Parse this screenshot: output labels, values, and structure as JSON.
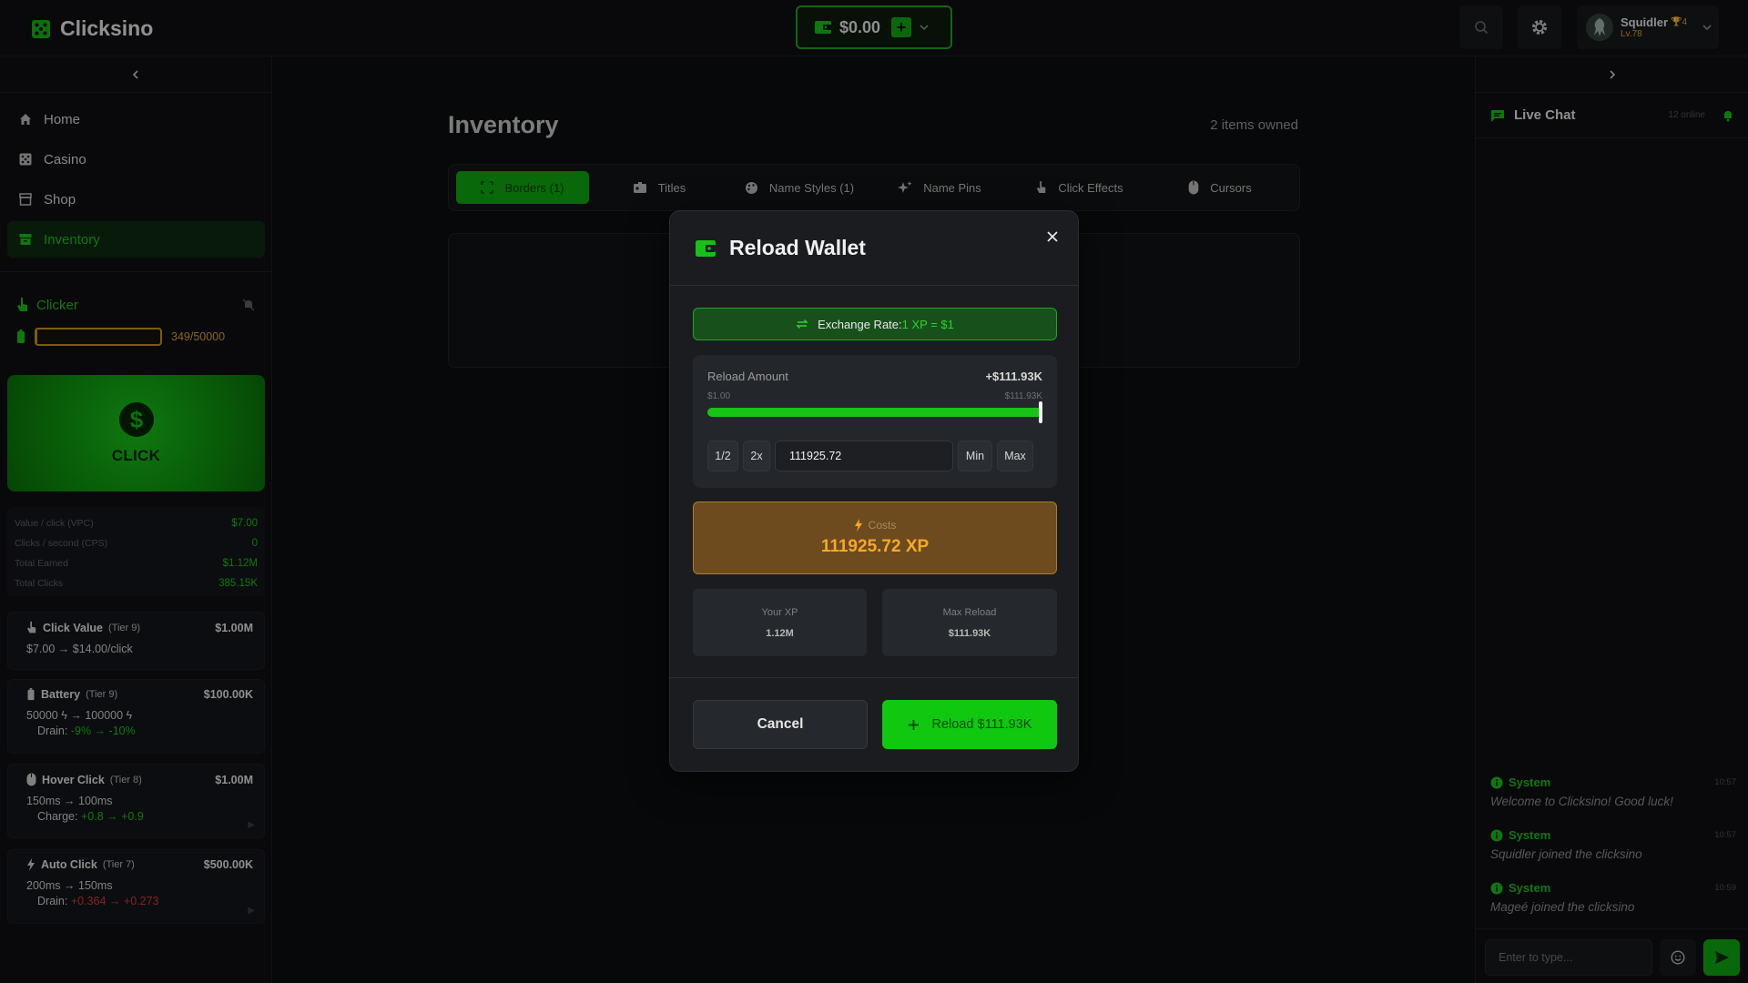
{
  "topbar": {
    "brand": "Clicksino",
    "wallet_amount": "$0.00",
    "wallet_add": "+",
    "profile": {
      "name": "Squidler",
      "level": "Lv.78",
      "badge_count": "4"
    }
  },
  "sidebar": {
    "nav": [
      {
        "label": "Home",
        "icon": "home-icon"
      },
      {
        "label": "Casino",
        "icon": "dice-icon"
      },
      {
        "label": "Shop",
        "icon": "store-icon"
      },
      {
        "label": "Inventory",
        "icon": "inventory-icon",
        "active": true
      }
    ],
    "clicker": {
      "title": "Clicker",
      "energy": "349/50000",
      "energy_fraction": 0.00698,
      "click_label": "CLICK"
    },
    "stats": [
      {
        "label": "Value / click (VPC)",
        "value": "$7.00"
      },
      {
        "label": "Clicks / second (CPS)",
        "value": "0"
      },
      {
        "label": "Total Earned",
        "value": "$1.12M"
      },
      {
        "label": "Total Clicks",
        "value": "385.15K"
      }
    ],
    "upgrades": [
      {
        "name": "Click Value",
        "tier": "(Tier 9)",
        "price": "$1.00M",
        "from": "$7.00",
        "to": "$14.00/click"
      },
      {
        "name": "Battery",
        "tier": "(Tier 9)",
        "price": "$100.00K",
        "from": "50000",
        "to": "100000",
        "drain_label": "Drain:",
        "drain_from": "-9%",
        "drain_to": "-10%"
      },
      {
        "name": "Hover Click",
        "tier": "(Tier 8)",
        "price": "$1.00M",
        "from": "150ms",
        "to": "100ms",
        "charge_label": "Charge:",
        "charge_from": "+0.8",
        "charge_to": "+0.9"
      },
      {
        "name": "Auto Click",
        "tier": "(Tier 7)",
        "price": "$500.00K",
        "from": "200ms",
        "to": "150ms",
        "drain_label": "Drain:",
        "drain_from": "+0.364",
        "drain_to": "+0.273"
      }
    ],
    "arrow": "→"
  },
  "main": {
    "title": "Inventory",
    "owned": "2 items owned",
    "tabs": [
      {
        "label": "Borders (1)",
        "icon": "border-icon",
        "active": true
      },
      {
        "label": "Titles",
        "icon": "id-card-icon"
      },
      {
        "label": "Name Styles (1)",
        "icon": "palette-icon"
      },
      {
        "label": "Name Pins",
        "icon": "sparkles-icon"
      },
      {
        "label": "Click Effects",
        "icon": "pointer-icon"
      },
      {
        "label": "Cursors",
        "icon": "mouse-icon"
      }
    ]
  },
  "chat": {
    "title": "Live Chat",
    "online": "12 online",
    "messages": [
      {
        "who": "System",
        "time": "10:57",
        "text": "Welcome to Clicksino! Good luck!"
      },
      {
        "who": "System",
        "time": "10:57",
        "text": "Squidler joined the clicksino"
      },
      {
        "who": "System",
        "time": "10:59",
        "text": "Mageé joined the clicksino"
      }
    ],
    "input_placeholder": "Enter to type..."
  },
  "modal": {
    "title": "Reload Wallet",
    "rate_label": "Exchange Rate:",
    "rate_value": "1 XP = $1",
    "amount_label": "Reload Amount",
    "amount_total": "+$111.93K",
    "min_label": "$1.00",
    "max_label": "$111.93K",
    "slider_fraction": 1.0,
    "buttons": {
      "half": "1/2",
      "double": "2x",
      "min": "Min",
      "max": "Max"
    },
    "input_value": "111925.72",
    "cost_label": "Costs",
    "cost_value": "111925.72 XP",
    "your_xp_label": "Your XP",
    "your_xp_value": "1.12M",
    "max_reload_label": "Max Reload",
    "max_reload_value": "$111.93K",
    "cancel": "Cancel",
    "reload": "Reload $111.93K"
  },
  "colors": {
    "accent": "#0fc80f",
    "warning": "#f5a92a",
    "danger": "#d33a3a",
    "bg": "#0b0c0e"
  }
}
